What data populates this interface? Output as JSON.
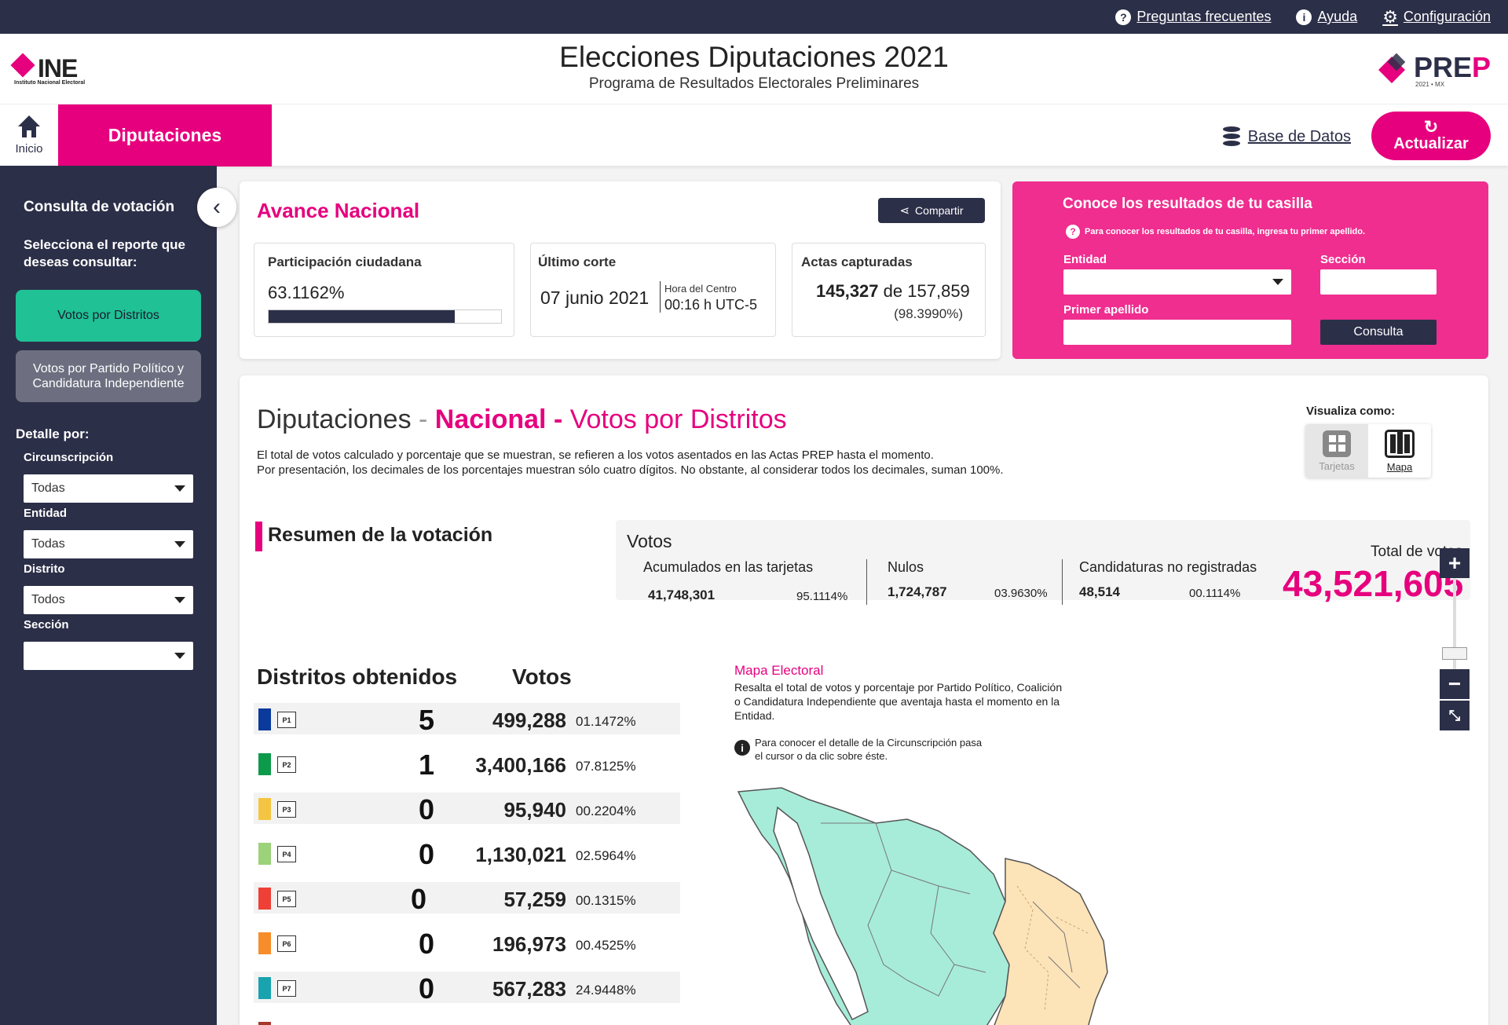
{
  "topbar": {
    "faq": "Preguntas frecuentes",
    "help": "Ayuda",
    "config": "Configuración"
  },
  "header": {
    "title": "Elecciones Diputaciones 2021",
    "subtitle": "Programa de Resultados Electorales Preliminares",
    "ine_logo": "INE",
    "ine_sub": "Instituto Nacional Electoral",
    "prep_logo_a": "PRE",
    "prep_logo_b": "P",
    "prep_sub": "2021 • MX"
  },
  "nav": {
    "home": "Inicio",
    "tab": "Diputaciones",
    "database": "Base de Datos",
    "refresh": "Actualizar"
  },
  "sidebar": {
    "title": "Consulta de votación",
    "subtitle": "Selecciona el reporte que deseas consultar:",
    "report_1": "Votos por Distritos",
    "report_2": "Votos por Partido Político y Candidatura Independiente",
    "detail": "Detalle por:",
    "filters": [
      {
        "label": "Circunscripción",
        "value": "Todas"
      },
      {
        "label": "Entidad",
        "value": "Todas"
      },
      {
        "label": "Distrito",
        "value": "Todos"
      },
      {
        "label": "Sección",
        "value": ""
      }
    ]
  },
  "avance": {
    "title": "Avance Nacional",
    "share": "Compartir",
    "participacion_label": "Participación ciudadana",
    "participacion_value": "63.1162%",
    "participacion_fraction": 0.8,
    "corte_label": "Último corte",
    "corte_date": "07 junio 2021",
    "corte_zone": "Hora del Centro",
    "corte_time": "00:16 h UTC-5",
    "actas_label": "Actas capturadas",
    "actas_captured": "145,327",
    "actas_de": "de",
    "actas_total": "157,859",
    "actas_pct": "(98.3990%)"
  },
  "casilla": {
    "title": "Conoce los resultados de tu casilla",
    "hint": "Para conocer los resultados de tu casilla, ingresa tu primer apellido.",
    "entidad": "Entidad",
    "seccion": "Sección",
    "apellido": "Primer apellido",
    "button": "Consulta"
  },
  "main": {
    "title_a": "Diputaciones",
    "title_dash1": " - ",
    "title_b": "Nacional",
    "title_dash2": " - ",
    "title_c": "Votos por Distritos",
    "desc_1": "El total de votos calculado y porcentaje que se muestran, se refieren a los votos asentados en las Actas PREP hasta el momento.",
    "desc_2": "Por presentación, los decimales de los porcentajes muestran sólo cuatro dígitos. No obstante, al considerar todos los decimales, suman 100%.",
    "viz_label": "Visualiza como:",
    "viz_cards": "Tarjetas",
    "viz_map": "Mapa"
  },
  "resumen": {
    "title": "Resumen de la votación",
    "votos_title": "Votos",
    "cols": [
      {
        "label": "Acumulados en las tarjetas",
        "value": "41,748,301",
        "pct": "95.1114%"
      },
      {
        "label": "Nulos",
        "value": "1,724,787",
        "pct": "03.9630%"
      },
      {
        "label": "Candidaturas no registradas",
        "value": "48,514",
        "pct": "00.1114%"
      }
    ],
    "total_label": "Total de votos",
    "total_value": "43,521,605"
  },
  "distritos": {
    "header_distritos": "Distritos obtenidos",
    "header_votos": "Votos",
    "rows": [
      {
        "party": "P1",
        "color": "#0a3a9c",
        "districts": "5",
        "votes": "499,288",
        "pct": "01.1472%"
      },
      {
        "party": "P2",
        "color": "#0d9a4b",
        "districts": "1",
        "votes": "3,400,166",
        "pct": "07.8125%"
      },
      {
        "party": "P3",
        "color": "#f4c542",
        "districts": "0",
        "votes": "95,940",
        "pct": "00.2204%"
      },
      {
        "party": "P4",
        "color": "#9bd27a",
        "districts": "0",
        "votes": "1,130,021",
        "pct": "02.5964%"
      },
      {
        "party": "P5",
        "color": "#ee4036",
        "districts": "0",
        "votes": "57,259",
        "pct": "00.1315%"
      },
      {
        "party": "P6",
        "color": "#f78d2a",
        "districts": "0",
        "votes": "196,973",
        "pct": "00.4525%"
      },
      {
        "party": "P7",
        "color": "#18a3ae",
        "districts": "0",
        "votes": "567,283",
        "pct": "24.9448%"
      }
    ]
  },
  "mapa": {
    "title": "Mapa Electoral",
    "desc": "Resalta el total de votos y porcentaje por Partido Político, Coalición o Candidatura Independiente que aventaja hasta el momento en la Entidad.",
    "info": "Para conocer el detalle de la Circunscripción pasa el cursor o da clic sobre éste.",
    "color_a": "#a7ecd9",
    "color_b": "#fde3b8"
  }
}
